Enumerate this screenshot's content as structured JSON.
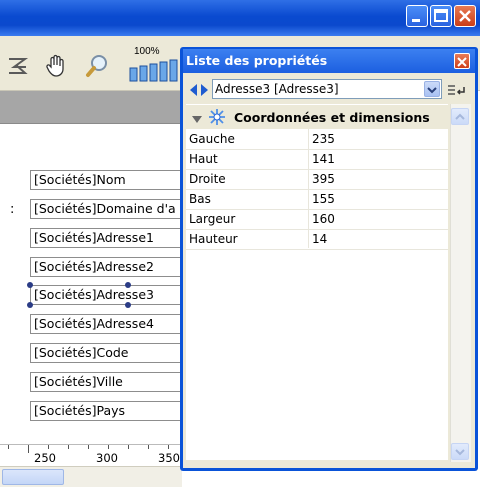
{
  "toolbar": {
    "zoom_label": "100%",
    "icons": [
      "align-icon",
      "hand-icon",
      "magnifier-icon",
      "zoom-bars-icon"
    ]
  },
  "design": {
    "fields": [
      "[Sociétés]Nom",
      "[Sociétés]Domaine d'a",
      "[Sociétés]Adresse1",
      "[Sociétés]Adresse2",
      "[Sociétés]Adresse3",
      "[Sociétés]Adresse4",
      "[Sociétés]Code",
      "[Sociétés]Ville",
      "[Sociétés]Pays"
    ],
    "colon": ":",
    "ruler": [
      "250",
      "300",
      "350"
    ]
  },
  "panel": {
    "title": "Liste des propriétés",
    "object_selector": "Adresse3 [Adresse3]",
    "section_title": "Coordonnées et dimensions",
    "properties": [
      {
        "name": "Gauche",
        "value": "235"
      },
      {
        "name": "Haut",
        "value": "141"
      },
      {
        "name": "Droite",
        "value": "395"
      },
      {
        "name": "Bas",
        "value": "155"
      },
      {
        "name": "Largeur",
        "value": "160"
      },
      {
        "name": "Hauteur",
        "value": "14"
      }
    ]
  },
  "colors": {
    "title_blue": "#0a4ad0",
    "panel_blue": "#0a53d8",
    "close_red": "#cf3f19",
    "chrome": "#ece9d8"
  }
}
